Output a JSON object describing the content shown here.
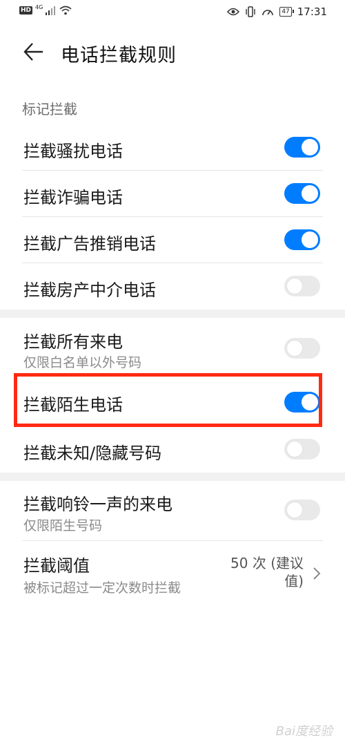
{
  "status_bar": {
    "hd": "HD",
    "network": "4G",
    "battery": "47",
    "time": "17:31"
  },
  "header": {
    "title": "电话拦截规则"
  },
  "section_mark": {
    "label": "标记拦截",
    "items": [
      {
        "label": "拦截骚扰电话",
        "on": true
      },
      {
        "label": "拦截诈骗电话",
        "on": true
      },
      {
        "label": "拦截广告推销电话",
        "on": true
      },
      {
        "label": "拦截房产中介电话",
        "on": false
      }
    ]
  },
  "section_calls": {
    "all_calls": {
      "label": "拦截所有来电",
      "subtitle": "仅限白名单以外号码",
      "on": false
    },
    "strangers": {
      "label": "拦截陌生电话",
      "on": true
    },
    "unknown": {
      "label": "拦截未知/隐藏号码",
      "on": false
    }
  },
  "section_other": {
    "one_ring": {
      "label": "拦截响铃一声的来电",
      "subtitle": "仅限陌生号码",
      "on": false
    },
    "threshold": {
      "label": "拦截阈值",
      "subtitle": "被标记超过一定次数时拦截",
      "value_line1": "50 次 (建议",
      "value_line2": "值)"
    }
  },
  "watermark": "Bai度经验",
  "colors": {
    "accent": "#007dff",
    "highlight": "#ff2a12"
  }
}
